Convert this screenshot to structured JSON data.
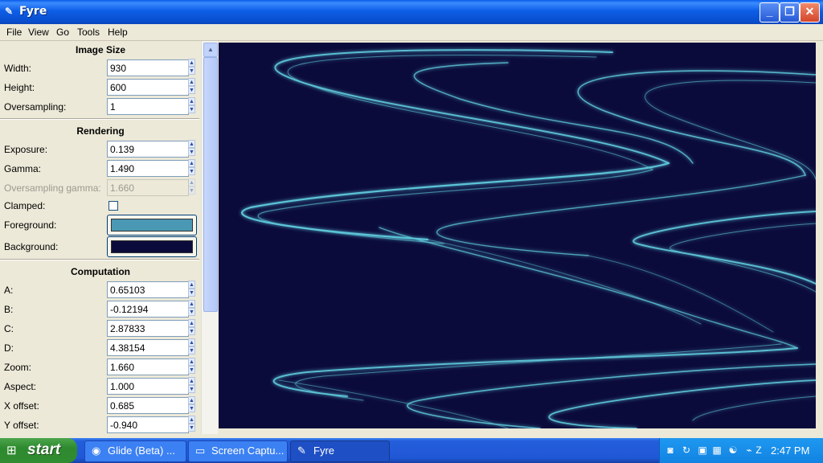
{
  "window": {
    "title": "Fyre",
    "icon": "fyre-app-icon"
  },
  "menu": [
    "File",
    "View",
    "Go",
    "Tools",
    "Help"
  ],
  "sections": {
    "image_size": "Image Size",
    "rendering": "Rendering",
    "computation": "Computation"
  },
  "image_size": {
    "width": {
      "label": "Width:",
      "value": "930"
    },
    "height": {
      "label": "Height:",
      "value": "600"
    },
    "oversampling": {
      "label": "Oversampling:",
      "value": "1"
    }
  },
  "rendering": {
    "exposure": {
      "label": "Exposure:",
      "value": "0.139"
    },
    "gamma": {
      "label": "Gamma:",
      "value": "1.490"
    },
    "oversampling_gamma": {
      "label": "Oversampling gamma:",
      "value": "1.660"
    },
    "clamped": {
      "label": "Clamped:",
      "checked": false
    },
    "foreground": {
      "label": "Foreground:",
      "color": "#4a98b4"
    },
    "background": {
      "label": "Background:",
      "color": "#0b0b3b"
    }
  },
  "computation": {
    "a": {
      "label": "A:",
      "value": "0.65103"
    },
    "b": {
      "label": "B:",
      "value": "-0.12194"
    },
    "c": {
      "label": "C:",
      "value": "2.87833"
    },
    "d": {
      "label": "D:",
      "value": "4.38154"
    },
    "zoom": {
      "label": "Zoom:",
      "value": "1.660"
    },
    "aspect": {
      "label": "Aspect:",
      "value": "1.000"
    },
    "x_offset": {
      "label": "X offset:",
      "value": "0.685"
    },
    "y_offset": {
      "label": "Y offset:",
      "value": "-0.940"
    }
  },
  "taskbar": {
    "start_label": "start",
    "tasks": [
      {
        "label": "Glide (Beta) ...",
        "icon": "firefox-icon"
      },
      {
        "label": "Screen Captu...",
        "icon": "folder-icon"
      },
      {
        "label": "Fyre",
        "icon": "fyre-app-icon"
      }
    ],
    "clock": "2:47 PM"
  }
}
